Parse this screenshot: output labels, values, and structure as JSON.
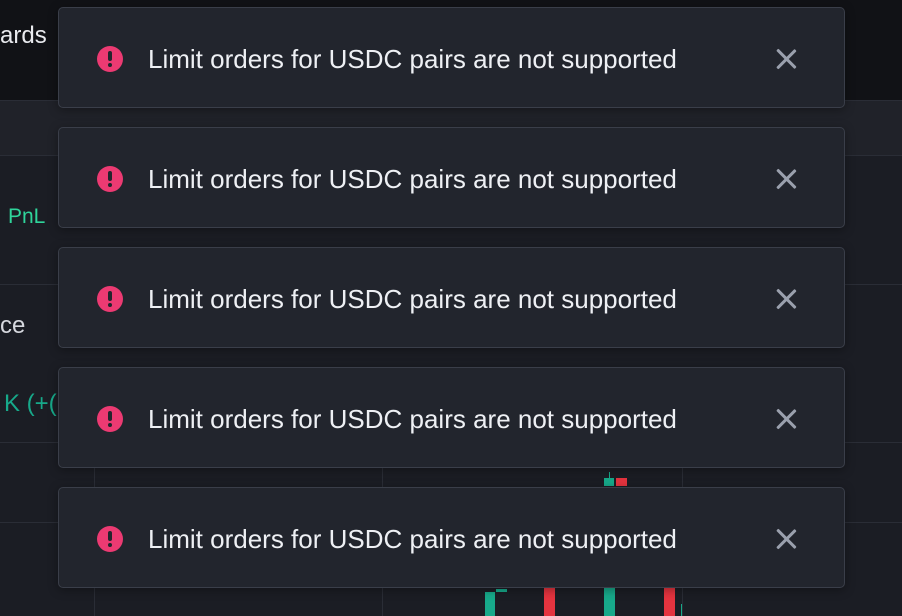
{
  "background": {
    "title_fragment": "ards",
    "pnl_label": "PnL",
    "price_fragment": "ce",
    "change_fragment": "K (+("
  },
  "toasts": [
    {
      "message": "Limit orders for USDC pairs are not supported",
      "icon": "alert-circle-icon",
      "close_icon": "close-icon"
    },
    {
      "message": "Limit orders for USDC pairs are not supported",
      "icon": "alert-circle-icon",
      "close_icon": "close-icon"
    },
    {
      "message": "Limit orders for USDC pairs are not supported",
      "icon": "alert-circle-icon",
      "close_icon": "close-icon"
    },
    {
      "message": "Limit orders for USDC pairs are not supported",
      "icon": "alert-circle-icon",
      "close_icon": "close-icon"
    },
    {
      "message": "Limit orders for USDC pairs are not supported",
      "icon": "alert-circle-icon",
      "close_icon": "close-icon"
    }
  ],
  "colors": {
    "alert": "#ec3a72",
    "profit": "#2fd59b",
    "candle_up": "#17a98a",
    "candle_down": "#e5343f"
  }
}
